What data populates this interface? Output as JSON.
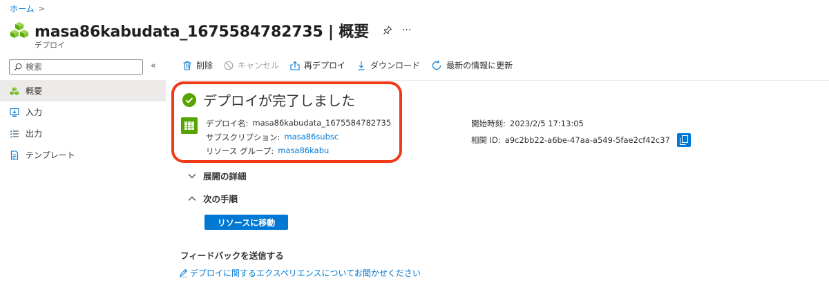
{
  "breadcrumb": {
    "home": "ホーム",
    "separator": ">"
  },
  "header": {
    "title": "masa86kabudata_1675584782735 | 概要",
    "subtitle": "デプロイ",
    "more": "···"
  },
  "sidebar": {
    "search_placeholder": "検索",
    "collapse": "«",
    "items": [
      {
        "label": "概要",
        "icon": "overview-icon",
        "active": true
      },
      {
        "label": "入力",
        "icon": "input-icon"
      },
      {
        "label": "出力",
        "icon": "output-icon"
      },
      {
        "label": "テンプレート",
        "icon": "template-icon"
      }
    ]
  },
  "toolbar": {
    "delete": "削除",
    "cancel": "キャンセル",
    "redeploy": "再デプロイ",
    "download": "ダウンロード",
    "refresh": "最新の情報に更新"
  },
  "status": {
    "title": "デプロイが完了しました",
    "color": "#57a300"
  },
  "details": {
    "name_label": "デプロイ名:",
    "name_value": "masa86kabudata_1675584782735",
    "subscription_label": "サブスクリプション:",
    "subscription_value": "masa86subsc",
    "resource_group_label": "リソース グループ:",
    "resource_group_value": "masa86kabu"
  },
  "info": {
    "start_label": "開始時刻:",
    "start_value": "2023/2/5 17:13:05",
    "correlation_label": "相関 ID:",
    "correlation_value": "a9c2bb22-a6be-47aa-a549-5fae2cf42c37"
  },
  "sections": {
    "deployment_details": "展開の詳細",
    "next_steps": "次の手順"
  },
  "go_to_resource": "リソースに移動",
  "feedback": {
    "title": "フィードバックを送信する",
    "link": "デプロイに関するエクスペリエンスについてお聞かせください"
  },
  "colors": {
    "accent": "#0078d4",
    "highlight": "#f03a17",
    "success": "#57a300"
  }
}
